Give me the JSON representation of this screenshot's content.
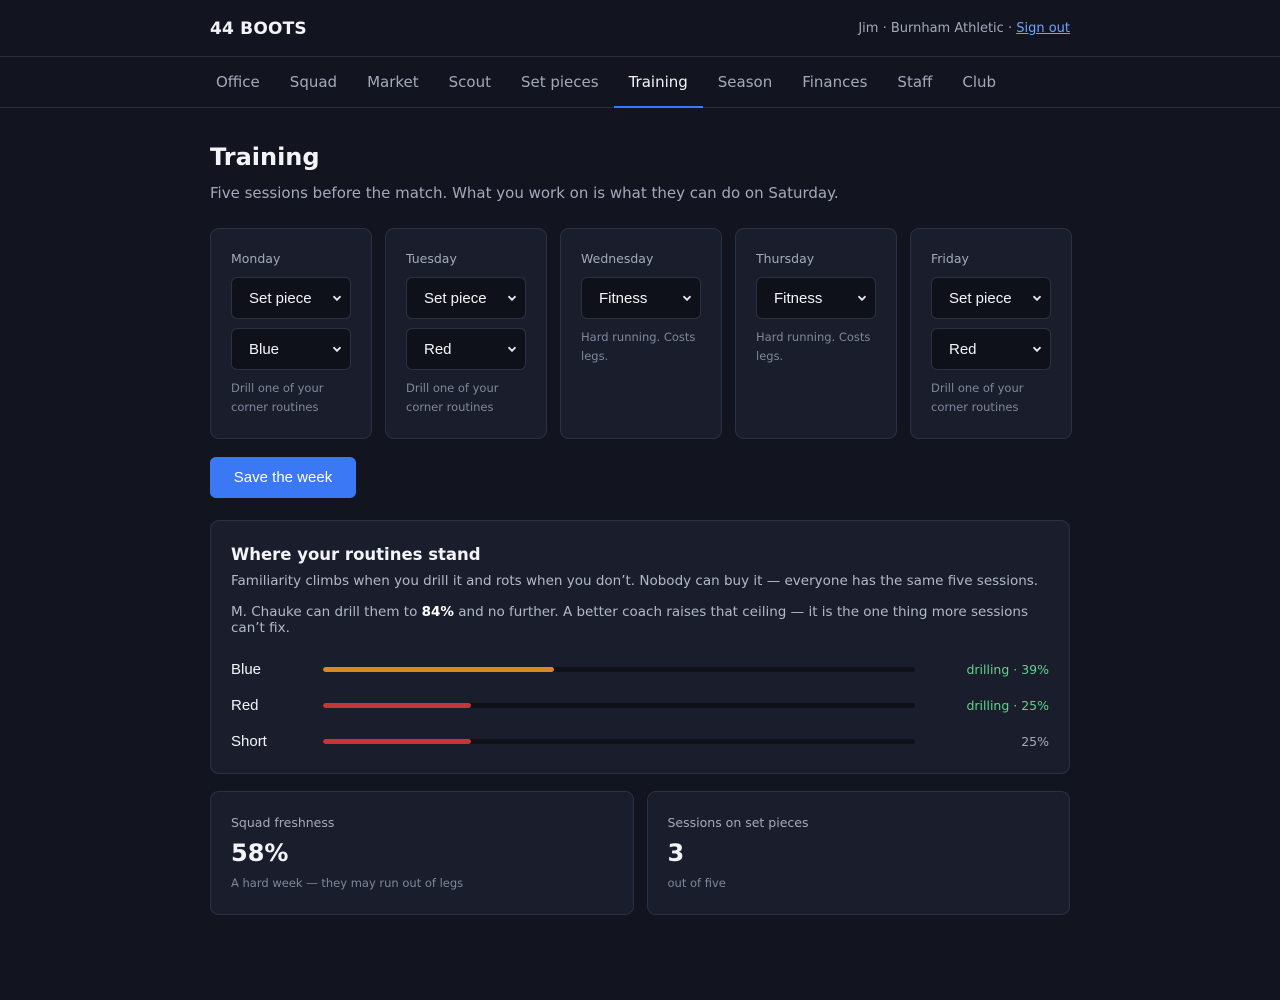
{
  "brand": "44 BOOTS",
  "account": {
    "text": "Jim · Burnham Athletic · ",
    "signout": "Sign out"
  },
  "nav": [
    "Office",
    "Squad",
    "Market",
    "Scout",
    "Set pieces",
    "Training",
    "Season",
    "Finances",
    "Staff",
    "Club"
  ],
  "nav_active": "Training",
  "page": {
    "title": "Training",
    "subtitle": "Five sessions before the match. What you work on is what they can do on Saturday."
  },
  "days": [
    {
      "name": "Monday",
      "session": "Set piece",
      "routine": "Blue",
      "note": "Drill one of your corner routines"
    },
    {
      "name": "Tuesday",
      "session": "Set piece",
      "routine": "Red",
      "note": "Drill one of your corner routines"
    },
    {
      "name": "Wednesday",
      "session": "Fitness",
      "routine": "",
      "note": "Hard running. Costs legs."
    },
    {
      "name": "Thursday",
      "session": "Fitness",
      "routine": "",
      "note": "Hard running. Costs legs."
    },
    {
      "name": "Friday",
      "session": "Set piece",
      "routine": "Red",
      "note": "Drill one of your corner routines"
    }
  ],
  "save_label": "Save the week",
  "routines": {
    "title": "Where your routines stand",
    "intro": "Familiarity climbs when you drill it and rots when you don’t. Nobody can buy it — everyone has the same five sessions.",
    "coach_pre": "M. Chauke can drill them to ",
    "coach_cap": "84%",
    "coach_post": " and no further. A better coach raises that ceiling — it is the one thing more sessions can’t fix.",
    "items": [
      {
        "name": "Blue",
        "familiarity": 39,
        "status": "drilling · 39%",
        "bar_color": "#d68a1f",
        "status_color": "#5fd18a"
      },
      {
        "name": "Red",
        "familiarity": 25,
        "status": "drilling · 25%",
        "bar_color": "#c63636",
        "status_color": "#5fd18a"
      },
      {
        "name": "Short",
        "familiarity": 25,
        "status": "25%",
        "bar_color": "#c63636",
        "status_color": "#a3a9b9"
      }
    ]
  },
  "stats": [
    {
      "label": "Squad freshness",
      "value": "58%",
      "note": "A hard week — they may run out of legs"
    },
    {
      "label": "Sessions on set pieces",
      "value": "3",
      "note": "out of five"
    }
  ],
  "colors": {
    "accent": "#3b78f5",
    "panel": "#1a1e2c",
    "background": "#12141f"
  },
  "icons": {
    "select": "chevron-down-icon"
  }
}
